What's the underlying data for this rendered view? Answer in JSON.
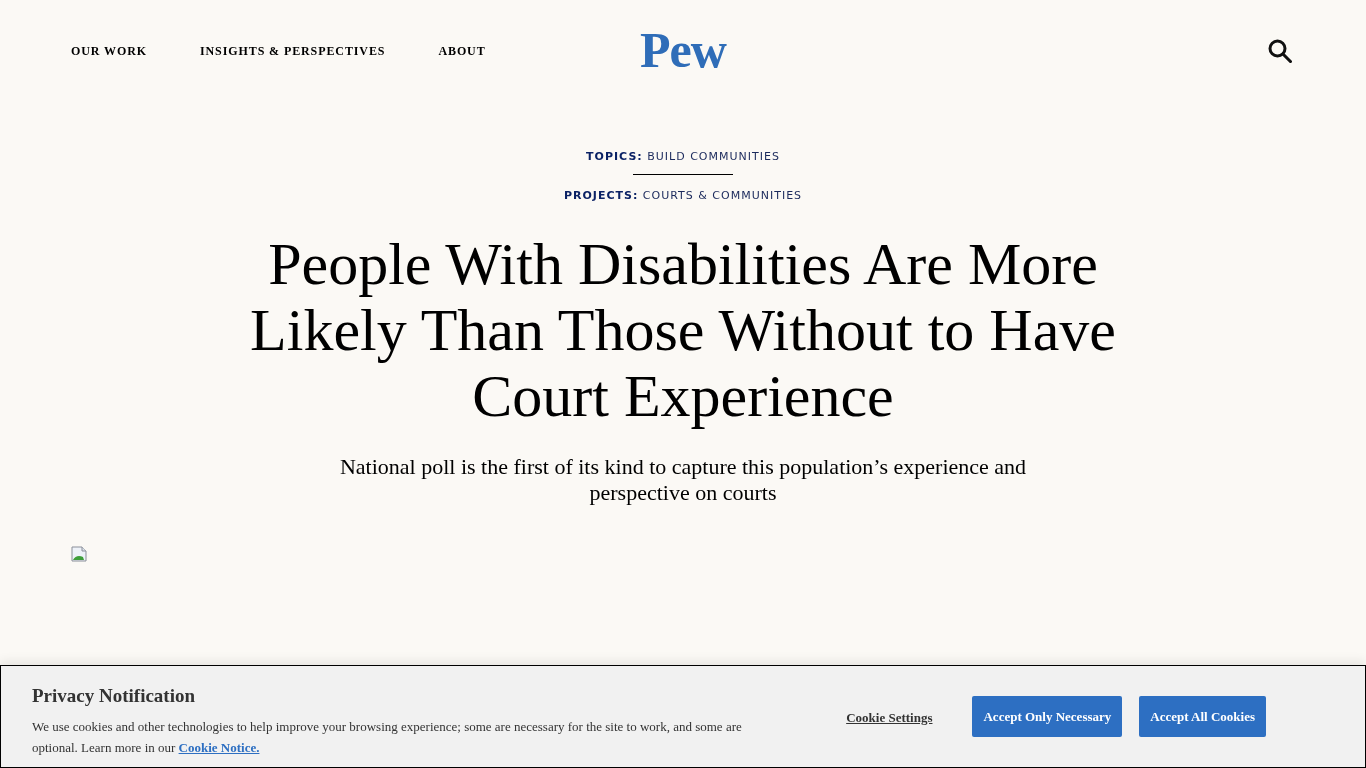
{
  "header": {
    "nav": [
      {
        "label": "OUR WORK"
      },
      {
        "label": "INSIGHTS & PERSPECTIVES"
      },
      {
        "label": "ABOUT"
      }
    ],
    "logo": "Pew"
  },
  "tags": [
    {
      "label": "TOPICS:",
      "value": "BUILD COMMUNITIES"
    },
    {
      "label": "PROJECTS:",
      "value": "COURTS & COMMUNITIES"
    }
  ],
  "article": {
    "title": "People With Disabilities Are More Likely Than Those Without to Have Court Experience",
    "subtitle": "National poll is the first of its kind to capture this population’s experience and perspective on courts"
  },
  "cookie_banner": {
    "title": "Privacy Notification",
    "text": "We use cookies and other technologies to help improve your browsing experience; some are necessary for the site to work, and some are optional. Learn more in our",
    "link": "Cookie Notice.",
    "buttons": [
      {
        "label": "Cookie Settings",
        "kind": "link"
      },
      {
        "label": "Accept Only Necessary",
        "kind": "primary"
      },
      {
        "label": "Accept All Cookies",
        "kind": "primary"
      }
    ]
  }
}
